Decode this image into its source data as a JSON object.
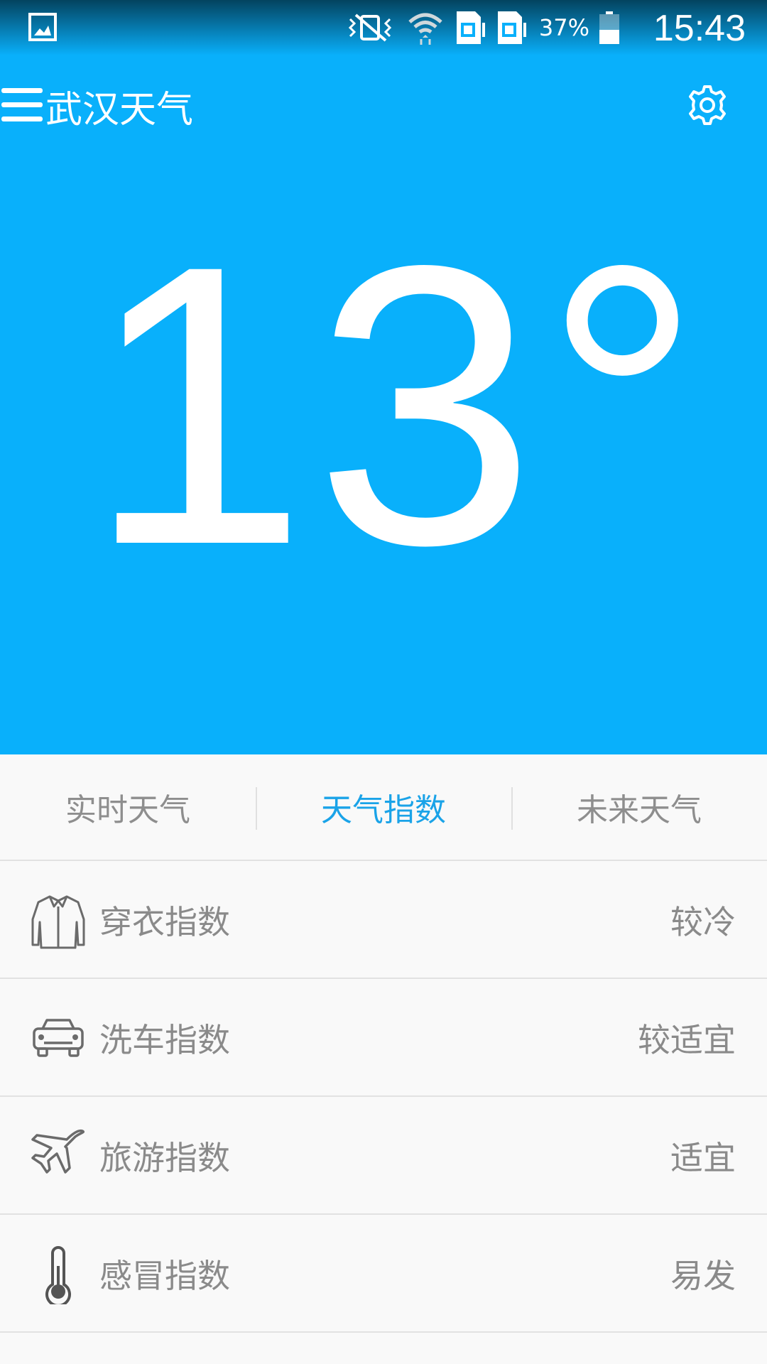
{
  "status_bar": {
    "battery_percent": "37%",
    "time": "15:43",
    "icons": [
      "gallery-icon",
      "vibrate-off-icon",
      "wifi-icon",
      "sim1-icon",
      "sim2-icon",
      "battery-icon"
    ]
  },
  "app_bar": {
    "title": "武汉天气",
    "menu_icon": "hamburger-menu-icon",
    "settings_icon": "gear-icon"
  },
  "current": {
    "temperature": "13°"
  },
  "tabs": [
    {
      "label": "实时天气",
      "active": false
    },
    {
      "label": "天气指数",
      "active": true
    },
    {
      "label": "未来天气",
      "active": false
    }
  ],
  "indices": [
    {
      "icon": "shirt-icon",
      "label": "穿衣指数",
      "value": "较冷"
    },
    {
      "icon": "car-icon",
      "label": "洗车指数",
      "value": "较适宜"
    },
    {
      "icon": "airplane-icon",
      "label": "旅游指数",
      "value": "适宜"
    },
    {
      "icon": "thermometer-icon",
      "label": "感冒指数",
      "value": "易发"
    }
  ],
  "colors": {
    "primary": "#09b0fb",
    "active_tab": "#1aa3e8",
    "text_gray": "#8a8a8a",
    "background": "#f9f9f9"
  }
}
